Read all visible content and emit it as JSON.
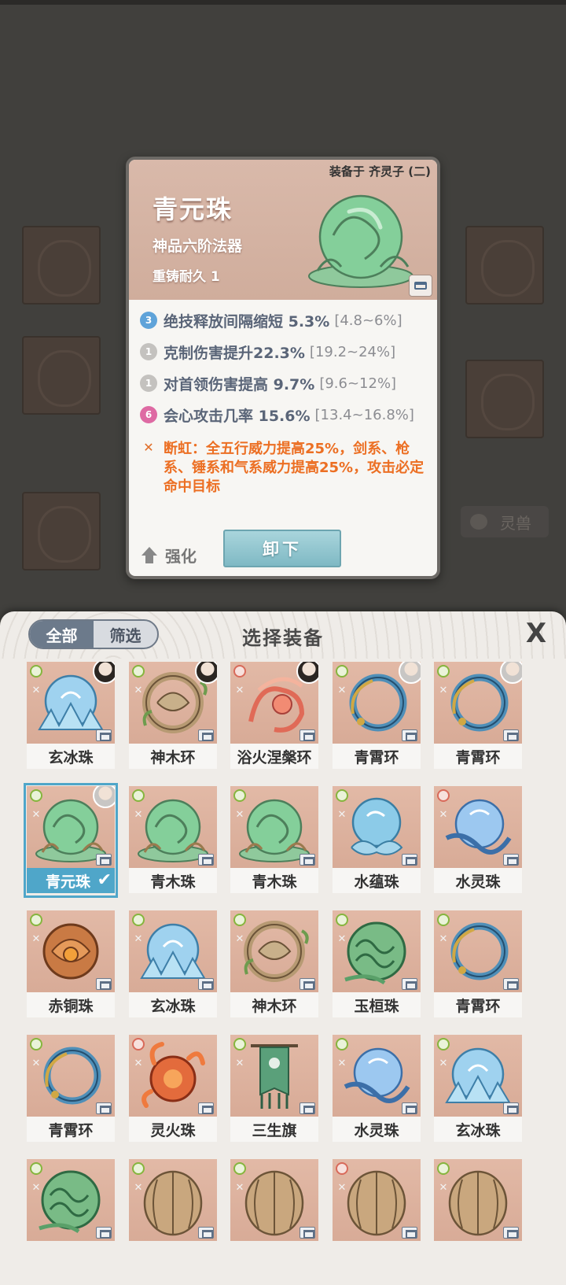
{
  "detail": {
    "equipped_on": "装备于 齐灵子 (二)",
    "name": "青元珠",
    "grade": "神品六阶法器",
    "recast": "重铸耐久 1",
    "attributes": [
      {
        "icon": "3",
        "kind": "blue",
        "text": "绝技释放间隔缩短 5.3%",
        "range": "[4.8~6%]"
      },
      {
        "icon": "1",
        "kind": "grey",
        "text": "克制伤害提升22.3%",
        "range": "[19.2~24%]"
      },
      {
        "icon": "1",
        "kind": "grey",
        "text": "对首领伤害提高 9.7%",
        "range": "[9.6~12%]"
      },
      {
        "icon": "6",
        "kind": "pink",
        "text": "会心攻击几率 15.6%",
        "range": "[13.4~16.8%]"
      }
    ],
    "special": "断虹：全五行威力提高25%，剑系、枪系、锤系和气系威力提高25%，攻击必定命中目标",
    "enhance_label": "强化",
    "unequip_label": "卸下"
  },
  "background": {
    "side_button": "灵兽"
  },
  "panel": {
    "tab_all": "全部",
    "tab_filter": "筛选",
    "title": "选择装备",
    "close": "X",
    "items": [
      {
        "name": "玄冰珠",
        "art": "ice",
        "avatar": "dark",
        "selected": false
      },
      {
        "name": "神木环",
        "art": "wood-ring",
        "avatar": "dark",
        "selected": false
      },
      {
        "name": "浴火涅槃环",
        "art": "phoenix",
        "avatar": "dark",
        "selected": false
      },
      {
        "name": "青霄环",
        "art": "blue-ring",
        "avatar": "light",
        "selected": false
      },
      {
        "name": "青霄环",
        "art": "blue-ring",
        "avatar": "light",
        "selected": false
      },
      {
        "name": "青元珠",
        "art": "green-orb",
        "avatar": "light",
        "selected": true
      },
      {
        "name": "青木珠",
        "art": "green-orb",
        "avatar": "",
        "selected": false
      },
      {
        "name": "青木珠",
        "art": "green-orb",
        "avatar": "",
        "selected": false
      },
      {
        "name": "水蕴珠",
        "art": "water-orb",
        "avatar": "",
        "selected": false
      },
      {
        "name": "水灵珠",
        "art": "water-spirit",
        "avatar": "",
        "selected": false
      },
      {
        "name": "赤铜珠",
        "art": "bronze-orb",
        "avatar": "",
        "selected": false
      },
      {
        "name": "玄冰珠",
        "art": "ice",
        "avatar": "",
        "selected": false
      },
      {
        "name": "神木环",
        "art": "wood-ring",
        "avatar": "",
        "selected": false
      },
      {
        "name": "玉桓珠",
        "art": "jade-orb",
        "avatar": "",
        "selected": false
      },
      {
        "name": "青霄环",
        "art": "blue-ring",
        "avatar": "",
        "selected": false
      },
      {
        "name": "青霄环",
        "art": "blue-ring",
        "avatar": "",
        "selected": false
      },
      {
        "name": "灵火珠",
        "art": "fire-orb",
        "avatar": "",
        "selected": false
      },
      {
        "name": "三生旗",
        "art": "banner",
        "avatar": "",
        "selected": false
      },
      {
        "name": "水灵珠",
        "art": "water-spirit",
        "avatar": "",
        "selected": false
      },
      {
        "name": "玄冰珠",
        "art": "ice",
        "avatar": "",
        "selected": false
      },
      {
        "name": "",
        "art": "jade-orb",
        "avatar": "",
        "selected": false
      },
      {
        "name": "",
        "art": "seed",
        "avatar": "",
        "selected": false
      },
      {
        "name": "",
        "art": "seed",
        "avatar": "",
        "selected": false
      },
      {
        "name": "",
        "art": "seed",
        "avatar": "",
        "selected": false
      },
      {
        "name": "",
        "art": "seed",
        "avatar": "",
        "selected": false
      }
    ]
  },
  "colors": {
    "accent_selected": "#4fa6c9",
    "special_text": "#ec6f23",
    "attr_text": "#5a6578"
  }
}
